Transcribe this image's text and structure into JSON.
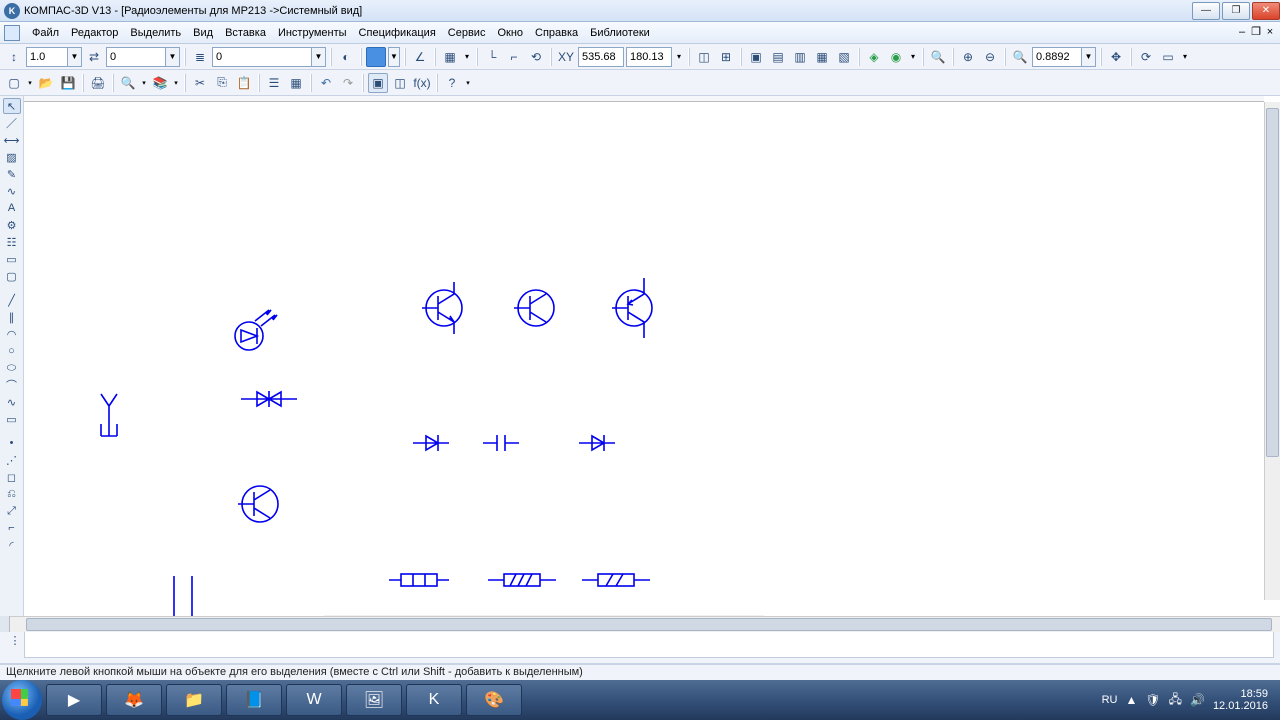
{
  "title": "КОМПАС-3D V13 - [Радиоэлементы для МР213 ->Системный вид]",
  "menu": [
    "Файл",
    "Редактор",
    "Выделить",
    "Вид",
    "Вставка",
    "Инструменты",
    "Спецификация",
    "Сервис",
    "Окно",
    "Справка",
    "Библиотеки"
  ],
  "toolbar1": {
    "scale": "1.0",
    "step": "0",
    "layer": "0",
    "coord_x": "535.68",
    "coord_y": "180.13",
    "zoom": "0.8892"
  },
  "hint": "Щелкните левой кнопкой мыши на объекте для его выделения (вместе с Ctrl или Shift - добавить к выделенным)",
  "tray": {
    "lang": "RU",
    "time": "18:59",
    "date": "12.01.2016"
  }
}
